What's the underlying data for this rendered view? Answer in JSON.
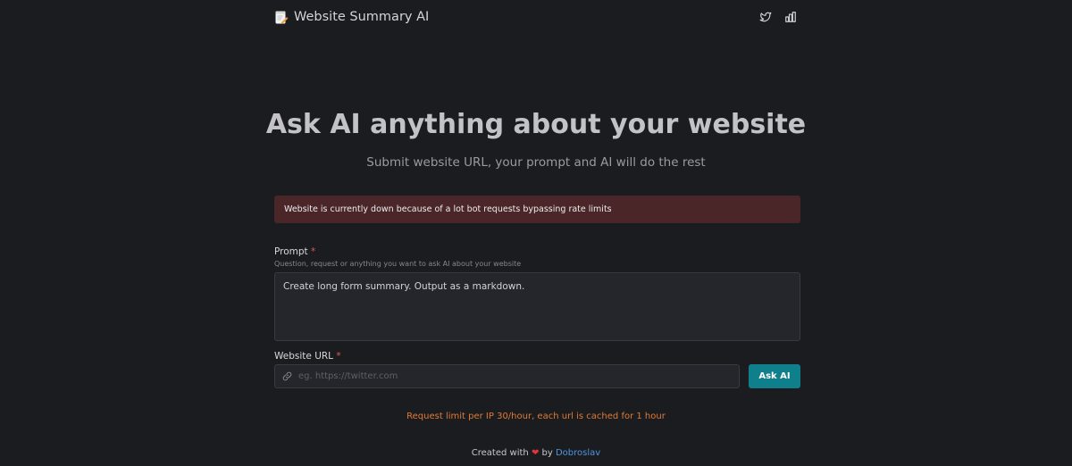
{
  "header": {
    "title": "Website Summary AI",
    "brand_icon": "memo-pencil-icon",
    "actions": [
      {
        "name": "twitter-icon"
      },
      {
        "name": "analytics-icon"
      }
    ]
  },
  "hero": {
    "title": "Ask AI anything about your website",
    "subtitle": "Submit website URL, your prompt and AI will do the rest"
  },
  "alert": {
    "message": "Website is currently down because of a lot bot requests bypassing rate limits",
    "color": "#4b2628"
  },
  "form": {
    "prompt": {
      "label": "Prompt",
      "required_mark": "*",
      "help": "Question, request or anything you want to ask AI about your website",
      "value": "Create long form summary. Output as a markdown."
    },
    "url": {
      "label": "Website URL",
      "required_mark": "*",
      "placeholder": "eg. https://twitter.com",
      "value": ""
    },
    "submit_label": "Ask AI"
  },
  "notice": "Request limit per IP 30/hour, each url is cached for 1 hour",
  "footer": {
    "prefix": "Created with",
    "heart": "❤",
    "by": "by",
    "author": "Dobroslav"
  },
  "colors": {
    "background": "#1b1c20",
    "accent": "#0f7f8c",
    "warning": "#e07a34",
    "link": "#4e94e0"
  }
}
